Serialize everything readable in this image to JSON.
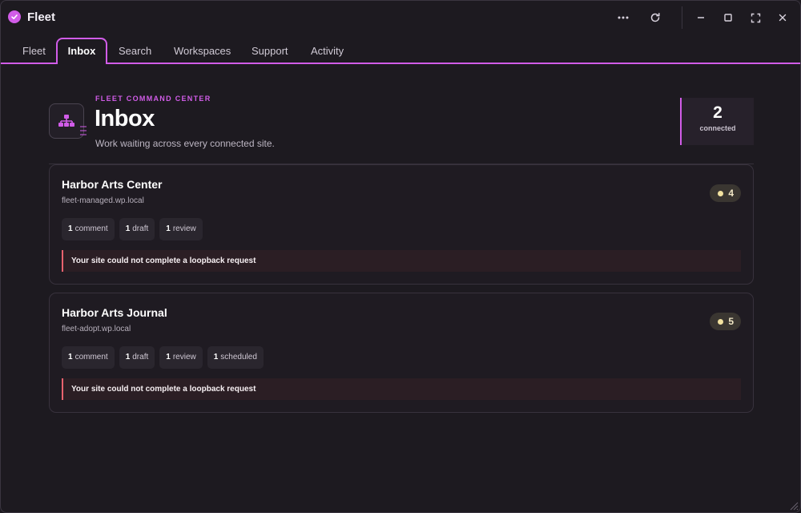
{
  "app": {
    "title": "Fleet"
  },
  "tabs": [
    {
      "label": "Fleet"
    },
    {
      "label": "Inbox"
    },
    {
      "label": "Search"
    },
    {
      "label": "Workspaces"
    },
    {
      "label": "Support"
    },
    {
      "label": "Activity"
    }
  ],
  "header": {
    "eyebrow": "FLEET COMMAND CENTER",
    "title": "Inbox",
    "subtitle": "Work waiting across every connected site.",
    "stat": {
      "value": "2",
      "label": "connected"
    }
  },
  "sites": [
    {
      "name": "Harbor Arts Center",
      "host": "fleet-managed.wp.local",
      "count": "4",
      "chips": [
        {
          "num": "1",
          "label": "comment"
        },
        {
          "num": "1",
          "label": "draft"
        },
        {
          "num": "1",
          "label": "review"
        }
      ],
      "alert": "Your site could not complete a loopback request"
    },
    {
      "name": "Harbor Arts Journal",
      "host": "fleet-adopt.wp.local",
      "count": "5",
      "chips": [
        {
          "num": "1",
          "label": "comment"
        },
        {
          "num": "1",
          "label": "draft"
        },
        {
          "num": "1",
          "label": "review"
        },
        {
          "num": "1",
          "label": "scheduled"
        }
      ],
      "alert": "Your site could not complete a loopback request"
    }
  ],
  "colors": {
    "accent": "#d15ce8",
    "alert": "#e8626e",
    "badge_dot": "#f2e2a0"
  },
  "icons": [
    "check-circle-icon",
    "more-icon",
    "refresh-icon",
    "minimize-icon",
    "maximize-icon",
    "fullscreen-icon",
    "close-icon",
    "sitemap-icon"
  ]
}
